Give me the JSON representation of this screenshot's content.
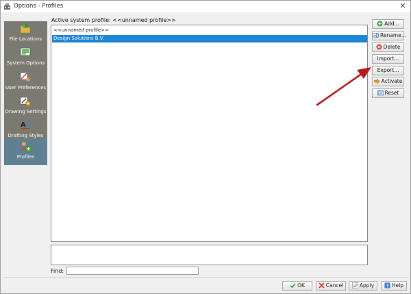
{
  "window": {
    "title": "Options - Profiles",
    "close_glyph": "✕"
  },
  "nav": {
    "items": [
      {
        "label": "File Locations",
        "icon": "folder-icon"
      },
      {
        "label": "System Options",
        "icon": "monitor-icon"
      },
      {
        "label": "User Preferences",
        "icon": "user-tools-icon"
      },
      {
        "label": "Drawing Settings",
        "icon": "drawing-settings-icon"
      },
      {
        "label": "Drafting Styles",
        "icon": "drafting-styles-icon"
      },
      {
        "label": "Profiles",
        "icon": "profiles-icon"
      }
    ],
    "active": "Profiles"
  },
  "profiles": {
    "active_label": "Active system profile: <<unnamed profile>>",
    "items": [
      "<<unnamed profile>>",
      "Design Solutions B.V."
    ],
    "selected": "Design Solutions B.V."
  },
  "side_buttons": {
    "add": "Add...",
    "rename": "Rename...",
    "delete": "Delete",
    "import": "Import...",
    "export": "Export...",
    "activate": "Activate",
    "reset": "Reset"
  },
  "find": {
    "label": "Find:",
    "value": ""
  },
  "footer": {
    "ok": "OK",
    "cancel": "Cancel",
    "apply": "Apply",
    "help": "Help"
  },
  "colors": {
    "nav_bg": "#7b7a72",
    "nav_active": "#5f7f92",
    "selection": "#1d84d6",
    "arrow": "#b5191b"
  }
}
